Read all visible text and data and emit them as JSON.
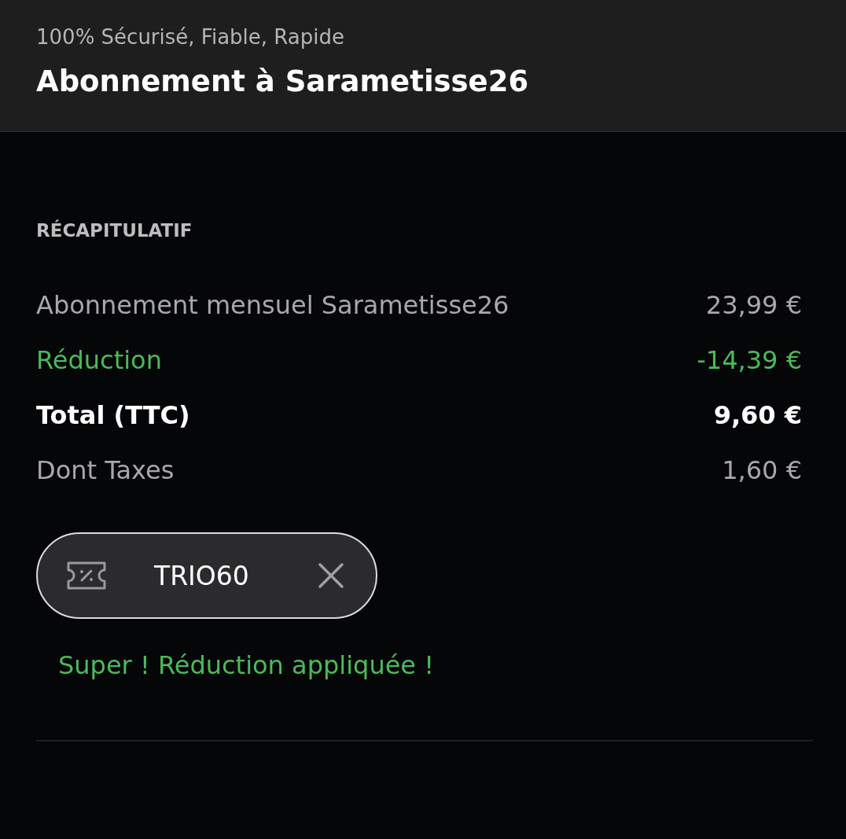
{
  "header": {
    "subtitle": "100% Sécurisé, Fiable, Rapide",
    "title": "Abonnement à Sarametisse26"
  },
  "summary": {
    "heading": "RÉCAPITULATIF",
    "rows": [
      {
        "kind": "normal",
        "label": "Abonnement mensuel Sarametisse26",
        "amount": "23,99 €"
      },
      {
        "kind": "discount",
        "label": "Réduction",
        "amount": "-14,39 €"
      },
      {
        "kind": "total",
        "label": "Total (TTC)",
        "amount": "9,60 €"
      },
      {
        "kind": "normal",
        "label": "Dont Taxes",
        "amount": "1,60 €"
      }
    ]
  },
  "coupon": {
    "code": "TRIO60"
  },
  "message": {
    "text": "Super ! Réduction appliquée !"
  }
}
